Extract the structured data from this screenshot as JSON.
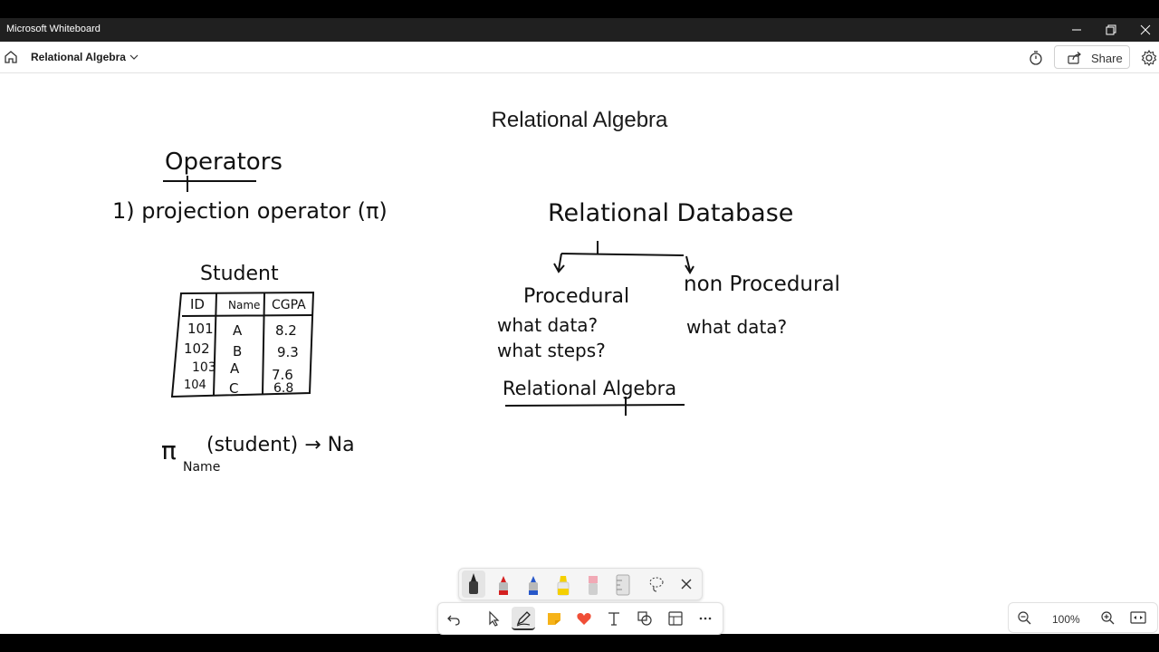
{
  "window": {
    "app_title": "Microsoft Whiteboard"
  },
  "header": {
    "board_title": "Relational Algebra",
    "share_label": "Share"
  },
  "canvas": {
    "title": "Relational Algebra",
    "ink": {
      "operators_heading": "Operators",
      "item1": "1) projection operator (π)",
      "table_title": "Student",
      "table_headers": [
        "ID",
        "Name",
        "CGPA"
      ],
      "table_rows": [
        [
          "101",
          "A",
          "8.2"
        ],
        [
          "102",
          "B",
          "9.3"
        ],
        [
          "103",
          "A",
          "7.6"
        ],
        [
          "104",
          "C",
          "6.8"
        ]
      ],
      "pi_symbol": "π",
      "pi_subscript": "Name",
      "pi_expression": "(student) → Na",
      "rdb_heading": "Relational Database",
      "procedural": "Procedural",
      "what_data_q1": "what data?",
      "what_steps_q": "what steps?",
      "non_procedural": "non Procedural",
      "what_data_q2": "what data?",
      "relational_algebra": "Relational Algebra"
    }
  },
  "zoom": {
    "level": "100%"
  }
}
